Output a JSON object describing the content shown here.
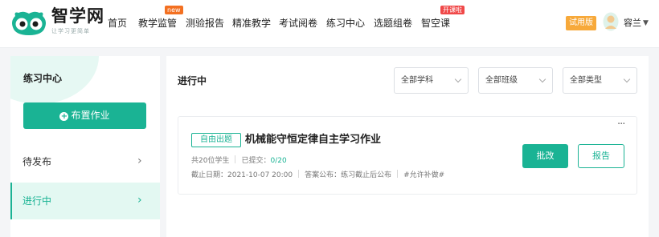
{
  "header": {
    "brand_name": "智学网",
    "brand_slogan": "让学习更简单",
    "nav": [
      {
        "label": "首页"
      },
      {
        "label": "教学监管",
        "badge": "new"
      },
      {
        "label": "测验报告"
      },
      {
        "label": "精准教学"
      },
      {
        "label": "考试阅卷"
      },
      {
        "label": "练习中心"
      },
      {
        "label": "选题组卷"
      },
      {
        "label": "智空课",
        "badge": "开课啦"
      }
    ],
    "trial_label": "试用版",
    "user_name": "容兰",
    "user_caret": "▼"
  },
  "sidebar": {
    "title": "练习中心",
    "assign_button": "布置作业",
    "items": [
      {
        "label": "待发布",
        "active": false
      },
      {
        "label": "进行中",
        "active": true
      }
    ]
  },
  "main": {
    "title": "进行中",
    "filters": [
      {
        "value": "全部学科"
      },
      {
        "value": "全部班级"
      },
      {
        "value": "全部类型"
      }
    ],
    "card": {
      "tag": "自由出题",
      "title": "机械能守恒定律自主学习作业",
      "students": "共20位学生",
      "submitted_label": "已提交：",
      "submitted_value": "0/20",
      "deadline": "截止日期：2021-10-07 20:00",
      "answer_publish": "答案公布：练习截止后公布",
      "makeup": "#允许补做#",
      "more": "···",
      "grade_button": "批改",
      "report_button": "报告"
    }
  },
  "colors": {
    "accent": "#1ab394",
    "trial": "#f7a93a",
    "badge_new": "#f37021",
    "badge_hot": "#f04848"
  },
  "icons": {
    "logo": "owl-logo-icon",
    "avatar": "user-avatar-icon",
    "plus": "plus-circle-icon",
    "chevron": "chevron-right-icon",
    "more": "more-dots-icon"
  }
}
